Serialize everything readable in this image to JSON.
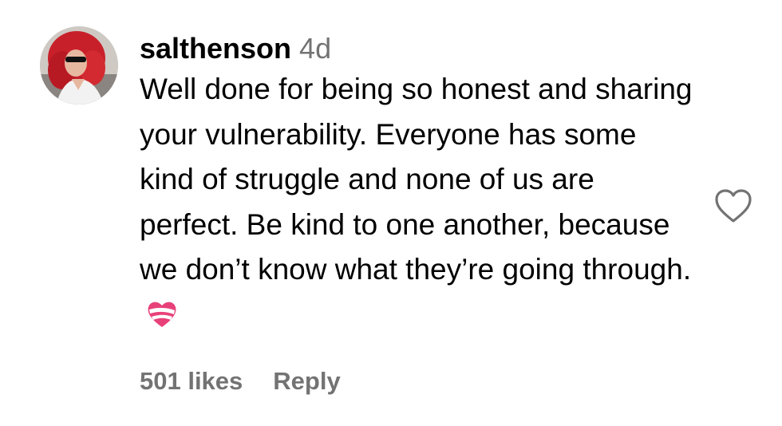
{
  "comment": {
    "username": "salthenson",
    "timestamp": "4d",
    "text": "Well done for being so honest and sharing your vulnerability. Everyone has some kind of struggle and none of us are perfect. Be kind to one another, because we don’t know what they’re going through.",
    "emoji": "heart-with-ribbon-emoji",
    "likes_label": "501 likes",
    "reply_label": "Reply",
    "like_icon": "heart-outline-icon",
    "colors": {
      "text": "#000000",
      "secondary": "#737373",
      "emoji_pink": "#e8417a"
    }
  }
}
